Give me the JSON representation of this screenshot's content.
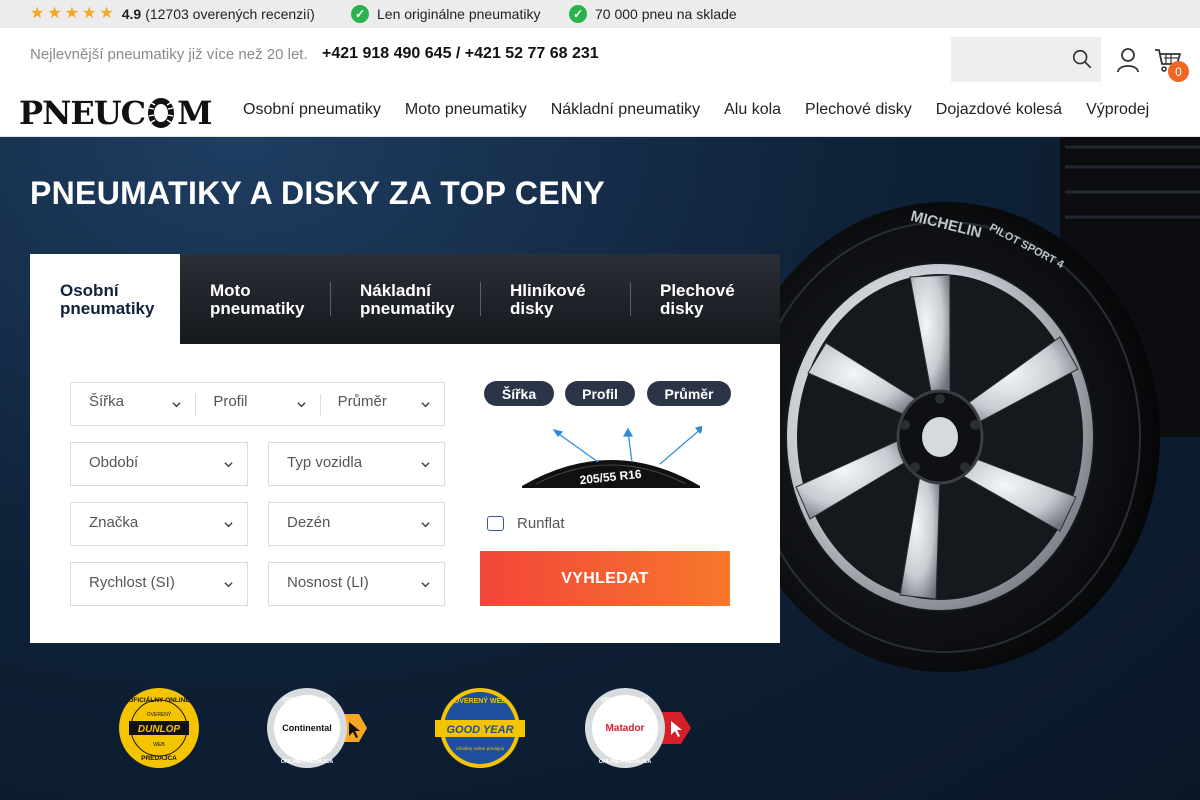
{
  "topbar": {
    "rating": "4.9",
    "reviews": "(12703 overených recenzií)",
    "usp1": "Len originálne pneumatiky",
    "usp2": "70 000 pneu na sklade"
  },
  "header": {
    "tagline": "Nejlevnější pneumatiky již více než 20 let.",
    "phones": "+421 918 490 645 / +421 52 77 68 231",
    "search_placeholder": "",
    "cart_count": "0"
  },
  "logo": {
    "left": "PNEUC",
    "right": "M"
  },
  "nav": [
    "Osobní pneumatiky",
    "Moto pneumatiky",
    "Nákladní pneumatiky",
    "Alu kola",
    "Plechové disky",
    "Dojazdové kolesá",
    "Výprodej"
  ],
  "hero": {
    "title": "PNEUMATIKY A DISKY ZA TOP CENY"
  },
  "tabs": [
    {
      "line1": "Osobní",
      "line2": "pneumatiky"
    },
    {
      "line1": "Moto",
      "line2": "pneumatiky"
    },
    {
      "line1": "Nákladní",
      "line2": "pneumatiky"
    },
    {
      "line1": "Hliníkové",
      "line2": "disky"
    },
    {
      "line1": "Plechové",
      "line2": "disky"
    }
  ],
  "form": {
    "width": "Šířka",
    "profile": "Profil",
    "diameter": "Průměr",
    "season": "Období",
    "vehicle_type": "Typ vozidla",
    "brand": "Značka",
    "pattern": "Dezén",
    "speed": "Rychlost (SI)",
    "load": "Nosnost (LI)",
    "pill_width": "Šířka",
    "pill_profile": "Profil",
    "pill_diameter": "Průměr",
    "tire_size": "205/55 R16",
    "runflat": "Runflat",
    "search_button": "VYHLEDAT"
  },
  "badges": {
    "dunlop_top": "OFICIÁLNY ONLINE",
    "dunlop_mid": "OVERENÝ",
    "dunlop_brand": "DUNLOP",
    "dunlop_sub": "WEB",
    "dunlop_bottom": "PREDAJCA",
    "continental_top": "CERTIFIKOVANÝ",
    "continental_brand": "Continental",
    "continental_bottom": "ONLINE PREDAJCA",
    "goodyear_top": "OVERENÝ WEB",
    "goodyear_brand": "GOOD YEAR",
    "goodyear_bottom": "oficiálny online predajca",
    "matador_top": "CERTIFIKOVANÝ",
    "matador_brand": "Matador",
    "matador_bottom": "ONLINE PREDAJCA"
  },
  "wheel": {
    "brand": "MICHELIN",
    "model": "PILOT SPORT 4"
  },
  "colors": {
    "accent": "#f26522",
    "navy": "#0f2239",
    "check": "#2bb24c",
    "star": "#f5a623"
  }
}
